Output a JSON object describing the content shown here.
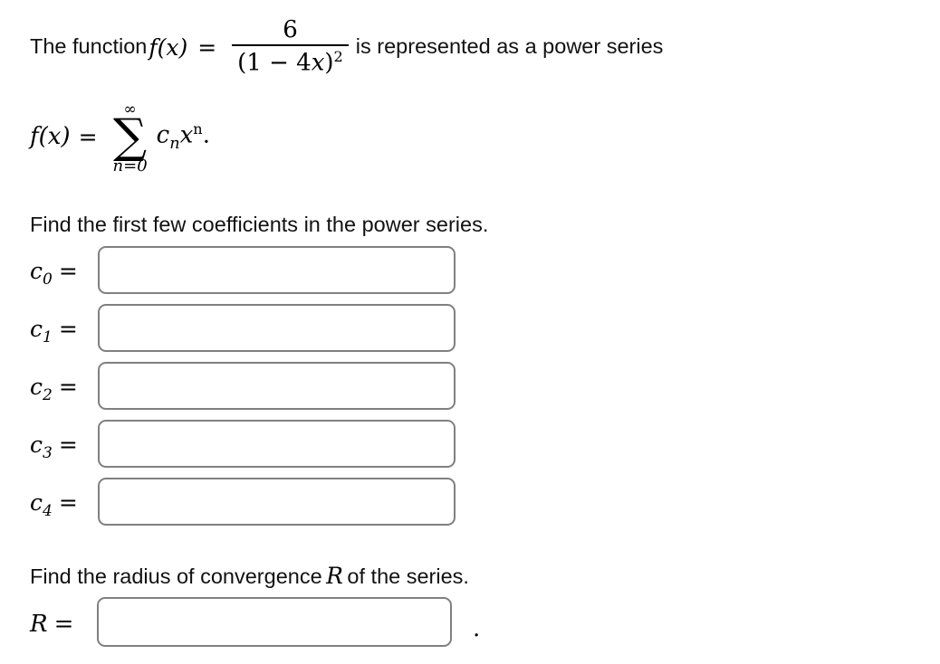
{
  "page": {
    "background_color": "#ffffff",
    "text_color": "#111111",
    "input_border_color": "#808080"
  },
  "statement": {
    "lead_text": "The function",
    "function_name": "f(x)",
    "equals": "=",
    "fraction": {
      "numerator": "6",
      "denominator_open": "(1 − 4",
      "denominator_var": "x",
      "denominator_close": ")",
      "denominator_exponent": "2"
    },
    "trail_text": "is represented as a power series"
  },
  "series": {
    "lhs": "f(x)",
    "equals": "=",
    "sigma": "∑",
    "limit_top": "∞",
    "limit_bottom": "n=0",
    "term_c": "c",
    "term_c_sub": "n",
    "term_x": "x",
    "term_x_sup": "n",
    "period": "."
  },
  "coefficients_section": {
    "prompt": "Find the first few coefficients in the power series.",
    "rows": [
      {
        "label_base": "c",
        "label_sub": "0",
        "equals": "=",
        "value": "",
        "placeholder": ""
      },
      {
        "label_base": "c",
        "label_sub": "1",
        "equals": "=",
        "value": "",
        "placeholder": ""
      },
      {
        "label_base": "c",
        "label_sub": "2",
        "equals": "=",
        "value": "",
        "placeholder": ""
      },
      {
        "label_base": "c",
        "label_sub": "3",
        "equals": "=",
        "value": "",
        "placeholder": ""
      },
      {
        "label_base": "c",
        "label_sub": "4",
        "equals": "=",
        "value": "",
        "placeholder": ""
      }
    ]
  },
  "radius_section": {
    "prompt_before": "Find the radius of convergence",
    "prompt_symbol": "R",
    "prompt_after": "of the series.",
    "label": "R",
    "equals": "=",
    "value": "",
    "placeholder": "",
    "period": "."
  }
}
